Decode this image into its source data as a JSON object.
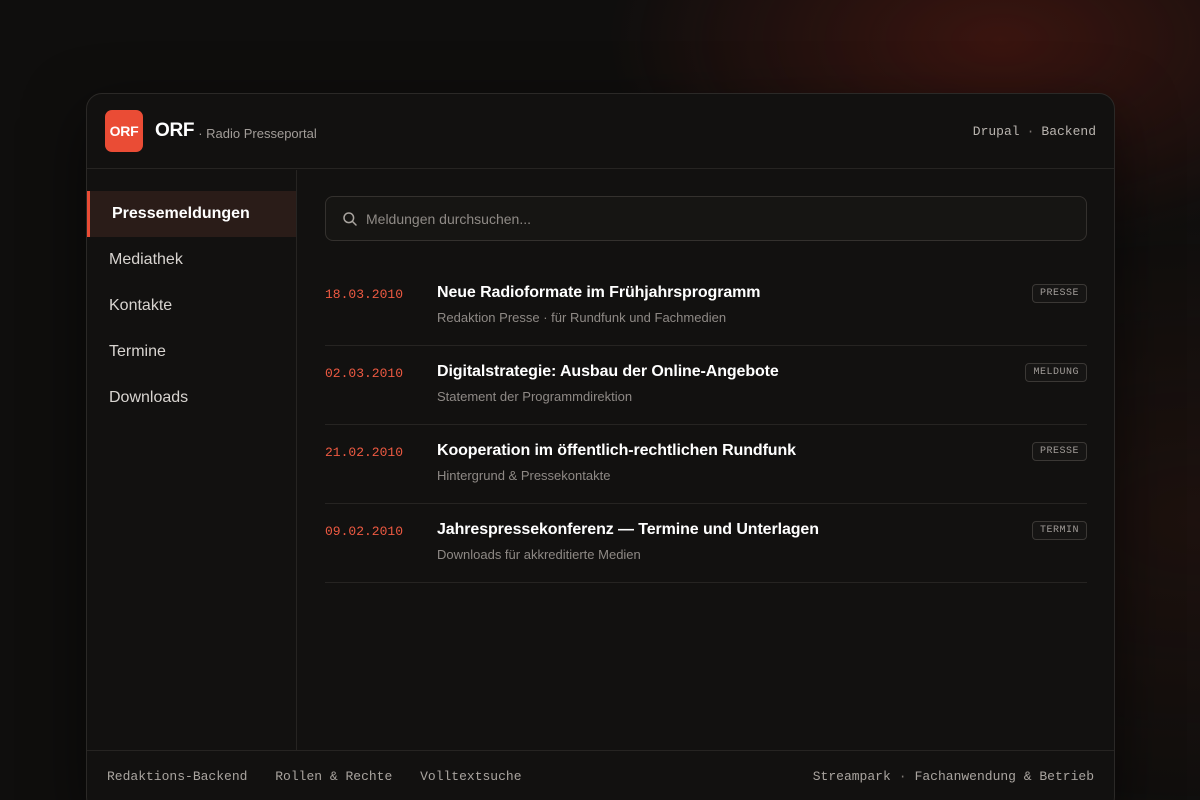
{
  "brand": {
    "logo_text": "ORF",
    "name": "ORF",
    "subtitle": "· Radio Presseportal"
  },
  "header": {
    "right_a": "Drupal",
    "separator": "·",
    "right_b": "Backend"
  },
  "sidebar": {
    "items": [
      {
        "label": "Pressemeldungen",
        "active": true
      },
      {
        "label": "Mediathek"
      },
      {
        "label": "Kontakte"
      },
      {
        "label": "Termine"
      },
      {
        "label": "Downloads"
      }
    ]
  },
  "search": {
    "placeholder": "Meldungen durchsuchen...",
    "icon": "search-icon"
  },
  "releases": [
    {
      "date": "18.03.2010",
      "title": "Neue Radioformate im Frühjahrsprogramm",
      "subtitle": "Redaktion Presse · für Rundfunk und Fachmedien",
      "tag": "PRESSE"
    },
    {
      "date": "02.03.2010",
      "title": "Digitalstrategie: Ausbau der Online-Angebote",
      "subtitle": "Statement der Programmdirektion",
      "tag": "MELDUNG"
    },
    {
      "date": "21.02.2010",
      "title": "Kooperation im öffentlich-rechtlichen Rundfunk",
      "subtitle": "Hintergrund & Pressekontakte",
      "tag": "PRESSE"
    },
    {
      "date": "09.02.2010",
      "title": "Jahrespressekonferenz — Termine und Unterlagen",
      "subtitle": "Downloads für akkreditierte Medien",
      "tag": "TERMIN"
    }
  ],
  "footer": {
    "links": [
      "Redaktions-Backend",
      "Rollen & Rechte",
      "Volltextsuche"
    ],
    "right_a": "Streampark",
    "separator": "·",
    "right_b": "Fachanwendung & Betrieb"
  },
  "colors": {
    "accent": "#ea4c35",
    "background": "#0f0e0d",
    "panel": "#121110"
  }
}
